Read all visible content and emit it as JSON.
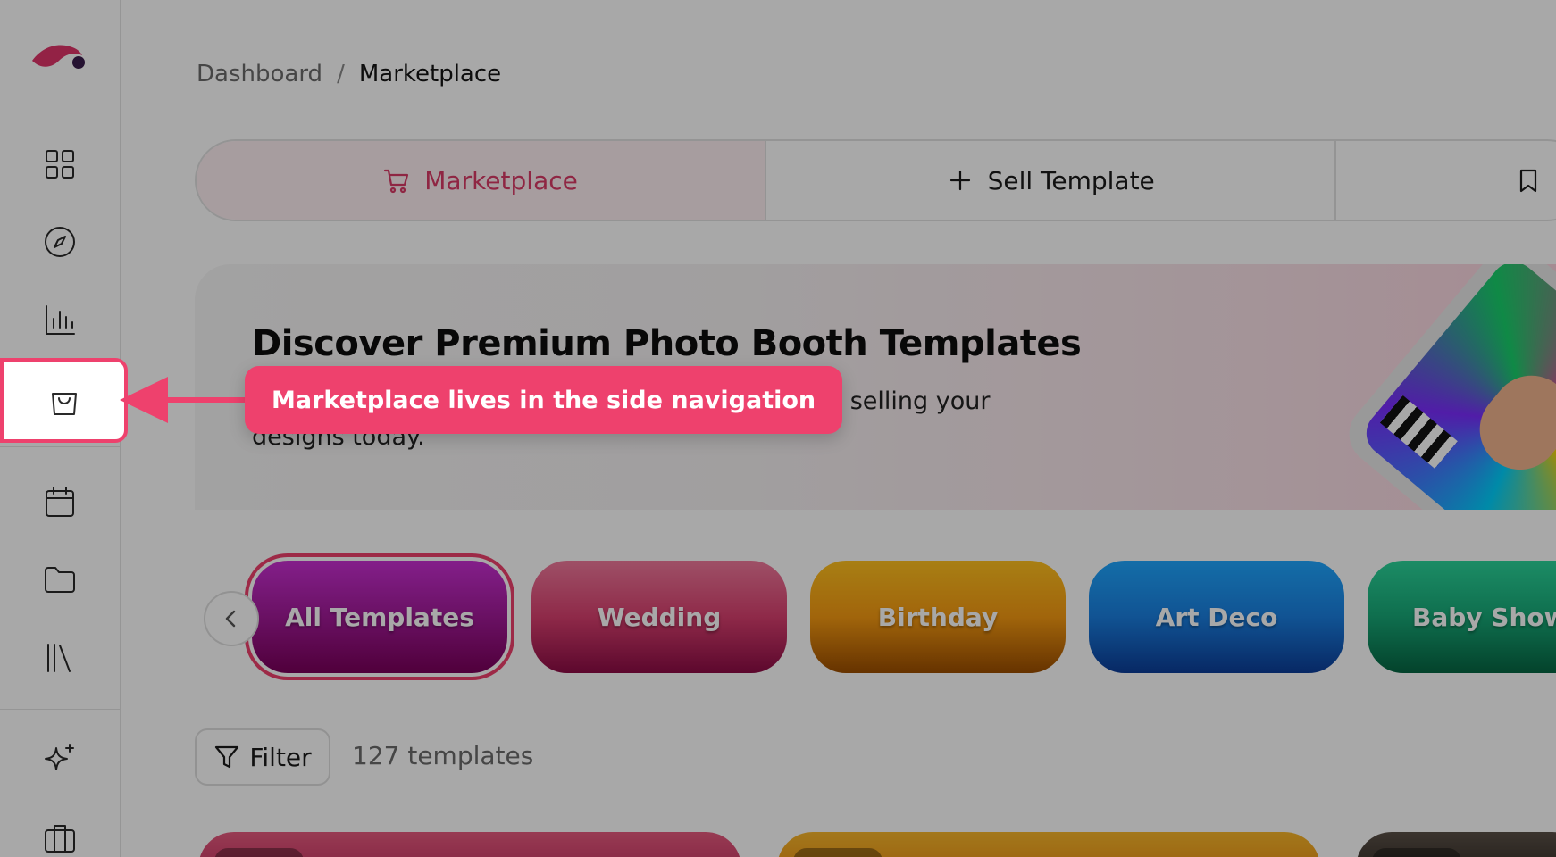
{
  "breadcrumb": {
    "parent": "Dashboard",
    "separator": "/",
    "current": "Marketplace"
  },
  "tabs": [
    {
      "label": "Marketplace",
      "icon": "cart-icon",
      "active": true
    },
    {
      "label": "Sell Template",
      "icon": "plus-icon",
      "active": false
    },
    {
      "label": "",
      "icon": "bookmark-icon",
      "active": false
    }
  ],
  "hero": {
    "title": "Discover Premium Photo Booth Templates",
    "subtitle_visible": ". Start selling your",
    "subtitle_line2": "designs today."
  },
  "categories": [
    {
      "label": "All Templates",
      "selected": true
    },
    {
      "label": "Wedding",
      "selected": false
    },
    {
      "label": "Birthday",
      "selected": false
    },
    {
      "label": "Art Deco",
      "selected": false
    },
    {
      "label": "Baby Showe",
      "selected": false
    }
  ],
  "filter": {
    "label": "Filter"
  },
  "template_count": "127 templates",
  "sidebar": {
    "items": [
      {
        "icon": "dashboard-grid-icon"
      },
      {
        "icon": "compass-icon"
      },
      {
        "icon": "bar-chart-icon"
      },
      {
        "icon": "shopping-bag-icon",
        "active": true
      },
      {
        "icon": "calendar-icon"
      },
      {
        "icon": "folder-icon"
      },
      {
        "icon": "library-icon"
      },
      {
        "icon": "sparkles-icon"
      },
      {
        "icon": "briefcase-icon"
      }
    ]
  },
  "tooltip": {
    "text": "Marketplace lives in the side navigation"
  },
  "colors": {
    "accent": "#ee416d",
    "overlay": "rgba(0,0,0,0.34)"
  }
}
